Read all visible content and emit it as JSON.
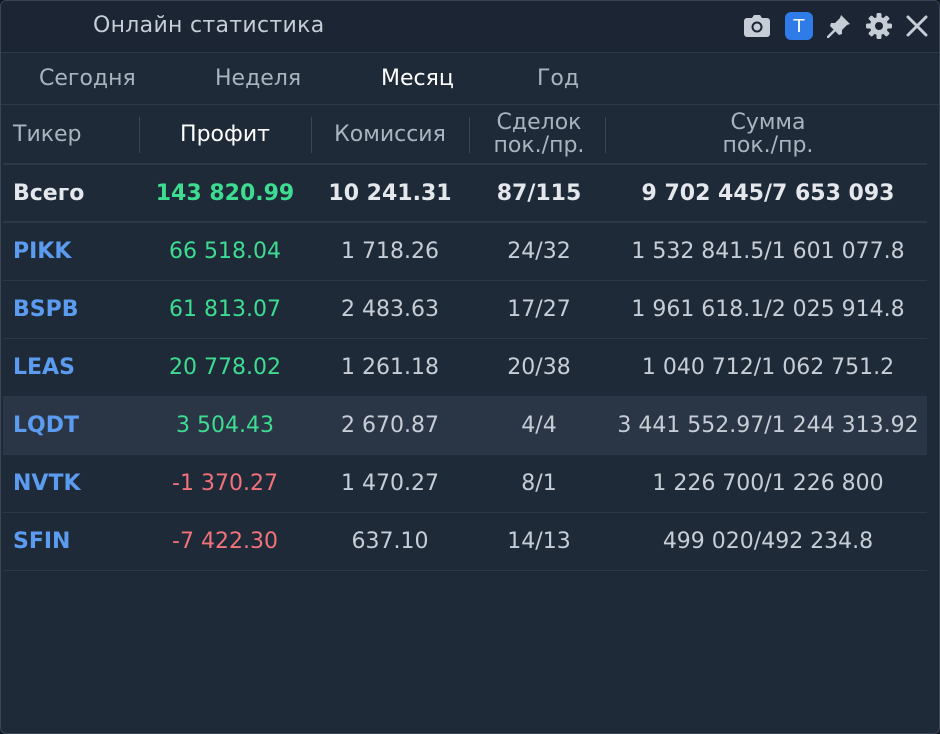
{
  "window": {
    "title": "Онлайн статистика",
    "t_badge": "T",
    "icons": [
      "camera-icon",
      "pin-icon",
      "gear-icon",
      "close-icon"
    ]
  },
  "tabs": [
    {
      "label": "Сегодня",
      "active": false
    },
    {
      "label": "Неделя",
      "active": false
    },
    {
      "label": "Месяц",
      "active": true
    },
    {
      "label": "Год",
      "active": false
    }
  ],
  "table": {
    "headers": {
      "ticker": "Тикер",
      "profit": "Профит",
      "commission": "Комиссия",
      "deals_1": "Сделок",
      "deals_2": "пок./пр.",
      "sum_1": "Сумма",
      "sum_2": "пок./пр."
    },
    "total": {
      "label": "Всего",
      "profit": "143 820.99",
      "commission": "10 241.31",
      "deals": "87/115",
      "sum": "9 702 445/7 653 093"
    },
    "rows": [
      {
        "ticker": "PIKK",
        "profit": "66 518.04",
        "commission": "1 718.26",
        "deals": "24/32",
        "sum": "1 532 841.5/1 601 077.8"
      },
      {
        "ticker": "BSPB",
        "profit": "61 813.07",
        "commission": "2 483.63",
        "deals": "17/27",
        "sum": "1 961 618.1/2 025 914.8"
      },
      {
        "ticker": "LEAS",
        "profit": "20 778.02",
        "commission": "1 261.18",
        "deals": "20/38",
        "sum": "1 040 712/1 062 751.2"
      },
      {
        "ticker": "LQDT",
        "profit": "3 504.43",
        "commission": "2 670.87",
        "deals": "4/4",
        "sum": "3 441 552.97/1 244 313.92"
      },
      {
        "ticker": "NVTK",
        "profit": "-1 370.27",
        "commission": "1 470.27",
        "deals": "8/1",
        "sum": "1 226 700/1 226 800"
      },
      {
        "ticker": "SFIN",
        "profit": "-7 422.30",
        "commission": "637.10",
        "deals": "14/13",
        "sum": "499 020/492 234.8"
      }
    ]
  },
  "colors": {
    "positive": "#3ddc91",
    "negative": "#f0727a",
    "ticker": "#5b9cf0",
    "accent": "#2f7be8",
    "background": "#1e2a38"
  }
}
